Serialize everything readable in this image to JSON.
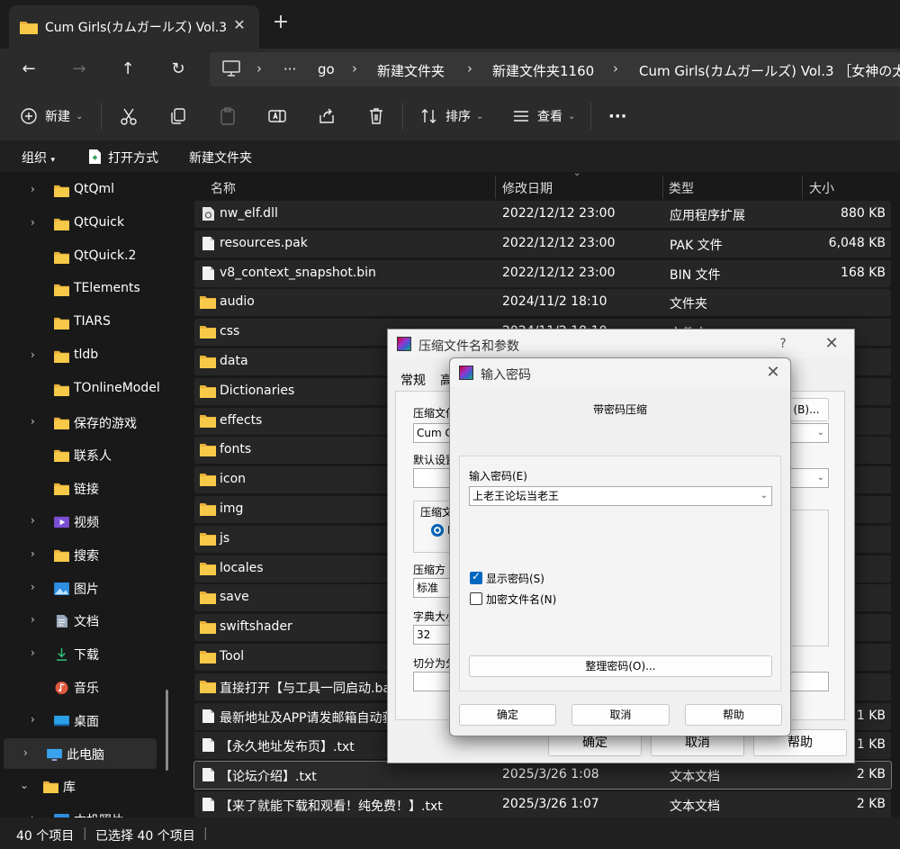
{
  "tab": {
    "title": "Cum Girls(カムガールズ) Vol.3",
    "close": "✕",
    "new": "+"
  },
  "nav": {
    "back": "←",
    "forward": "→",
    "up": "↑",
    "refresh": "↻",
    "more": "···",
    "crumbs": [
      "go",
      "新建文件夹",
      "新建文件夹1160",
      "Cum Girls(カムガールズ) Vol.3 ［女神の太"
    ],
    "sep": "›"
  },
  "commands": {
    "new": "新建",
    "sort": "排序",
    "view": "查看",
    "more": "···"
  },
  "subbar": {
    "organize": "组织",
    "open_with": "打开方式",
    "new_folder": "新建文件夹"
  },
  "sidebar": {
    "items": [
      {
        "label": "QtQml",
        "chev": "›",
        "icon": "folder"
      },
      {
        "label": "QtQuick",
        "chev": "›",
        "icon": "folder"
      },
      {
        "label": "QtQuick.2",
        "chev": "",
        "icon": "folder"
      },
      {
        "label": "TElements",
        "chev": "",
        "icon": "folder"
      },
      {
        "label": "TIARS",
        "chev": "",
        "icon": "folder"
      },
      {
        "label": "tldb",
        "chev": "›",
        "icon": "folder"
      },
      {
        "label": "TOnlineModel",
        "chev": "",
        "icon": "folder"
      },
      {
        "label": "保存的游戏",
        "chev": "›",
        "icon": "folder"
      },
      {
        "label": "联系人",
        "chev": "",
        "icon": "folder"
      },
      {
        "label": "链接",
        "chev": "",
        "icon": "folder"
      },
      {
        "label": "视频",
        "chev": "›",
        "icon": "video"
      },
      {
        "label": "搜索",
        "chev": "›",
        "icon": "folder"
      },
      {
        "label": "图片",
        "chev": "›",
        "icon": "picture"
      },
      {
        "label": "文档",
        "chev": "›",
        "icon": "document"
      },
      {
        "label": "下载",
        "chev": "›",
        "icon": "download"
      },
      {
        "label": "音乐",
        "chev": "",
        "icon": "music"
      },
      {
        "label": "桌面",
        "chev": "›",
        "icon": "desktop"
      },
      {
        "label": "此电脑",
        "chev": "›",
        "icon": "computer"
      },
      {
        "label": "库",
        "chev": "⌄",
        "icon": "folder"
      },
      {
        "label": "本机照片",
        "chev": "›",
        "icon": "picture"
      }
    ]
  },
  "columns": {
    "name": "名称",
    "date": "修改日期",
    "type": "类型",
    "size": "大小"
  },
  "files": [
    {
      "name": "nw_elf.dll",
      "date": "2022/12/12 23:00",
      "type": "应用程序扩展",
      "size": "880 KB",
      "icon": "dll"
    },
    {
      "name": "resources.pak",
      "date": "2022/12/12 23:00",
      "type": "PAK 文件",
      "size": "6,048 KB",
      "icon": "file"
    },
    {
      "name": "v8_context_snapshot.bin",
      "date": "2022/12/12 23:00",
      "type": "BIN 文件",
      "size": "168 KB",
      "icon": "file"
    },
    {
      "name": "audio",
      "date": "2024/11/2 18:10",
      "type": "文件夹",
      "size": "",
      "icon": "folder"
    },
    {
      "name": "css",
      "date": "2024/11/2 18:10",
      "type": "文件夹",
      "size": "",
      "icon": "folder"
    },
    {
      "name": "data",
      "date": "",
      "type": "",
      "size": "",
      "icon": "folder"
    },
    {
      "name": "Dictionaries",
      "date": "",
      "type": "",
      "size": "",
      "icon": "folder"
    },
    {
      "name": "effects",
      "date": "",
      "type": "",
      "size": "",
      "icon": "folder"
    },
    {
      "name": "fonts",
      "date": "",
      "type": "",
      "size": "",
      "icon": "folder"
    },
    {
      "name": "icon",
      "date": "",
      "type": "",
      "size": "",
      "icon": "folder"
    },
    {
      "name": "img",
      "date": "",
      "type": "",
      "size": "",
      "icon": "folder"
    },
    {
      "name": "js",
      "date": "",
      "type": "",
      "size": "",
      "icon": "folder"
    },
    {
      "name": "locales",
      "date": "",
      "type": "",
      "size": "",
      "icon": "folder"
    },
    {
      "name": "save",
      "date": "",
      "type": "",
      "size": "",
      "icon": "folder"
    },
    {
      "name": "swiftshader",
      "date": "",
      "type": "",
      "size": "",
      "icon": "folder"
    },
    {
      "name": "Tool",
      "date": "",
      "type": "",
      "size": "",
      "icon": "folder"
    },
    {
      "name": "直接打开【与工具一同启动.bat",
      "date": "",
      "type": "",
      "size": "",
      "icon": "folder"
    },
    {
      "name": "最新地址及APP请发邮箱自动获",
      "date": "",
      "type": "",
      "size": "1 KB",
      "icon": "file"
    },
    {
      "name": "【永久地址发布页】.txt",
      "date": "",
      "type": "",
      "size": "1 KB",
      "icon": "file"
    },
    {
      "name": "【论坛介绍】.txt",
      "date": "2025/3/26 1:08",
      "type": "文本文档",
      "size": "2 KB",
      "icon": "file"
    },
    {
      "name": "【来了就能下载和观看！纯免费！】.txt",
      "date": "2025/3/26 1:07",
      "type": "文本文档",
      "size": "2 KB",
      "icon": "file"
    }
  ],
  "status": {
    "count": "40 个项目",
    "selected": "已选择 40 个项目"
  },
  "archive_dialog": {
    "title": "压缩文件名和参数",
    "help": "?",
    "close": "✕",
    "tab_general": "常规",
    "tab_advanced": "高",
    "label_archive_name": "压缩文件",
    "archive_name_value": "Cum G",
    "browse": "(B)...",
    "label_profile": "默认设置",
    "label_format": "压缩文",
    "format_radio": "R",
    "label_method": "压缩方",
    "method_value": "标准",
    "label_dict": "字典大小",
    "dict_value": "32",
    "label_split": "切分为分",
    "ok": "确定",
    "cancel": "取消",
    "helpbtn": "帮助"
  },
  "password_dialog": {
    "title": "输入密码",
    "close": "✕",
    "heading": "带密码压缩",
    "label_password": "输入密码(E)",
    "password_value": "上老王论坛当老王",
    "show_password": "显示密码(S)",
    "encrypt_names": "加密文件名(N)",
    "organize": "整理密码(O)...",
    "ok": "确定",
    "cancel": "取消",
    "help": "帮助"
  }
}
